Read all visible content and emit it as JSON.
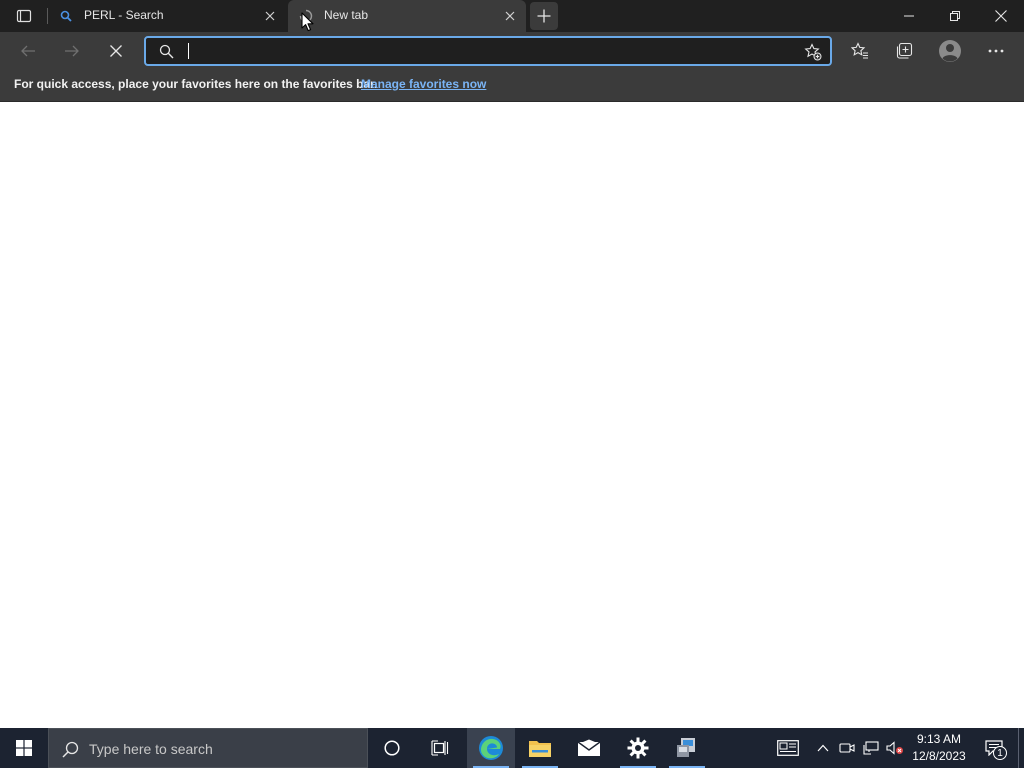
{
  "browser": {
    "tabs": [
      {
        "title": "PERL - Search",
        "active": false,
        "icon": "search-icon"
      },
      {
        "title": "New tab",
        "active": true,
        "icon": "loading-icon"
      }
    ],
    "new_tab_icon": "plus-icon",
    "window_controls": [
      "minimize-icon",
      "restore-icon",
      "close-icon"
    ]
  },
  "toolbar": {
    "back_icon": "arrow-left-icon",
    "forward_icon": "arrow-right-icon",
    "stop_icon": "close-icon",
    "address": {
      "value": "",
      "search_icon": "search-icon",
      "favorite_icon": "star-add-icon"
    },
    "right_icons": [
      "favorites-icon",
      "collections-icon",
      "profile-icon",
      "more-icon"
    ]
  },
  "favorites_bar": {
    "message": "For quick access, place your favorites here on the favorites bar.",
    "link": "Manage favorites now"
  },
  "taskbar": {
    "search_placeholder": "Type here to search",
    "apps": [
      "cortana-icon",
      "task-view-icon",
      "edge-icon",
      "file-explorer-icon",
      "mail-icon",
      "settings-icon",
      "network-app-icon"
    ],
    "tray_icons": [
      "news-icon",
      "chevron-up-icon",
      "meet-now-icon",
      "network-icon",
      "volume-muted-icon"
    ],
    "clock": {
      "time": "9:13 AM",
      "date": "12/8/2023"
    },
    "notification_count": "1"
  },
  "colors": {
    "titlebar": "#202020",
    "toolbar": "#3b3b3b",
    "address_focus": "#6aa9e8",
    "link": "#7ab4f5",
    "taskbar": "#1c2331"
  }
}
